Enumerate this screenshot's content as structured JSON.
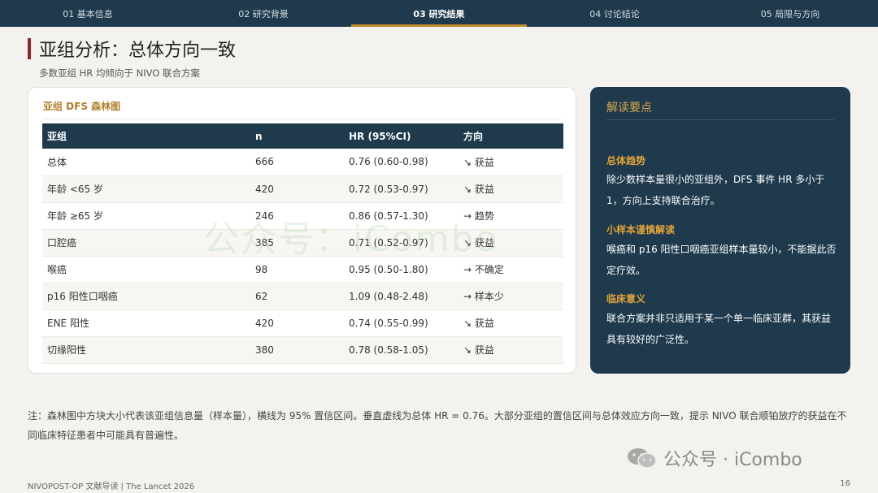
{
  "nav": {
    "tabs": [
      {
        "label": "01 基本信息"
      },
      {
        "label": "02 研究背景"
      },
      {
        "label": "03 研究结果"
      },
      {
        "label": "04 讨论结论"
      },
      {
        "label": "05 局限与方向"
      }
    ],
    "active_index": 2
  },
  "header": {
    "title": "亚组分析：总体方向一致",
    "subtitle": "多数亚组 HR 均倾向于 NIVO 联合方案"
  },
  "table_card": {
    "title": "亚组 DFS 森林图",
    "columns": [
      "亚组",
      "n",
      "HR (95%CI)",
      "方向"
    ],
    "rows": [
      {
        "group": "总体",
        "n": "666",
        "hr": "0.76 (0.60-0.98)",
        "direction": "↘ 获益"
      },
      {
        "group": "年龄 <65 岁",
        "n": "420",
        "hr": "0.72 (0.53-0.97)",
        "direction": "↘ 获益"
      },
      {
        "group": "年龄 ≥65 岁",
        "n": "246",
        "hr": "0.86 (0.57-1.30)",
        "direction": "→ 趋势"
      },
      {
        "group": "口腔癌",
        "n": "385",
        "hr": "0.71 (0.52-0.97)",
        "direction": "↘ 获益"
      },
      {
        "group": "喉癌",
        "n": "98",
        "hr": "0.95 (0.50-1.80)",
        "direction": "→ 不确定"
      },
      {
        "group": "p16 阳性口咽癌",
        "n": "62",
        "hr": "1.09 (0.48-2.48)",
        "direction": "→ 样本少"
      },
      {
        "group": "ENE 阳性",
        "n": "420",
        "hr": "0.74 (0.55-0.99)",
        "direction": "↘ 获益"
      },
      {
        "group": "切缘阳性",
        "n": "380",
        "hr": "0.78 (0.58-1.05)",
        "direction": "↘ 获益"
      }
    ]
  },
  "watermark": "公众号：iCombo",
  "panel": {
    "title": "解读要点",
    "sections": [
      {
        "heading": "总体趋势",
        "body": "除少数样本量很小的亚组外，DFS 事件 HR 多小于 1，方向上支持联合治疗。"
      },
      {
        "heading": "小样本谨慎解读",
        "body": "喉癌和 p16 阳性口咽癌亚组样本量较小，不能据此否定疗效。"
      },
      {
        "heading": "临床意义",
        "body": "联合方案并非只适用于某一个单一临床亚群，其获益具有较好的广泛性。"
      }
    ]
  },
  "footnote": "注：森林图中方块大小代表该亚组信息量（样本量），横线为 95% 置信区间。垂直虚线为总体 HR = 0.76。大部分亚组的置信区间与总体效应方向一致，提示 NIVO 联合顺铂放疗的获益在不同临床特征患者中可能具有普遍性。",
  "footer": {
    "left": "NIVOPOST-OP 文献导读 | The Lancet 2026",
    "page": "16",
    "brand": "公众号 · iCombo"
  },
  "colors": {
    "navy": "#1e3a4c",
    "gold": "#c28a2e",
    "accent_red": "#8b2a2a"
  }
}
